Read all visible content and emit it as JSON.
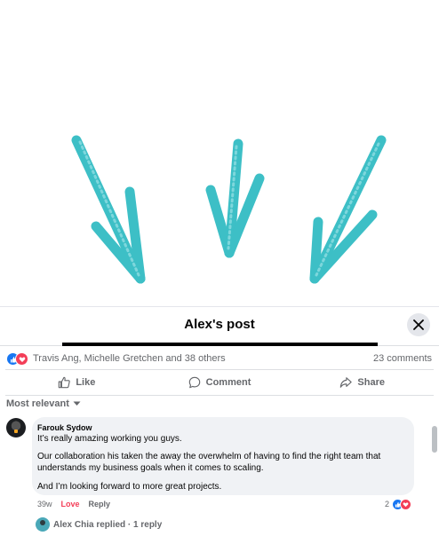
{
  "header": {
    "title": "Alex's post",
    "close_icon": "close-icon"
  },
  "colors": {
    "arrow": "#33bcc4",
    "like": "#1877f2",
    "love": "#f33e58",
    "bubble": "#f0f2f5"
  },
  "reactions": {
    "icons": [
      "like-reaction-icon",
      "love-reaction-icon"
    ],
    "names": "Travis Ang, Michelle Gretchen and 38 others",
    "comments": "23 comments"
  },
  "actions": {
    "like": "Like",
    "comment": "Comment",
    "share": "Share"
  },
  "sort": {
    "label": "Most relevant"
  },
  "comment": {
    "author": "Farouk Sydow",
    "p1": "It’s really amazing working you guys.",
    "p2": "Our collaboration his taken the away the overwhelm of having to find the right team that understands my business goals when it comes to scaling.",
    "p3": "And I’m looking forward to more great projects.",
    "time": "39w",
    "love_label": "Love",
    "reply_label": "Reply",
    "reaction_count": "2"
  },
  "replies": {
    "text": "Alex Chia replied · 1 reply"
  }
}
